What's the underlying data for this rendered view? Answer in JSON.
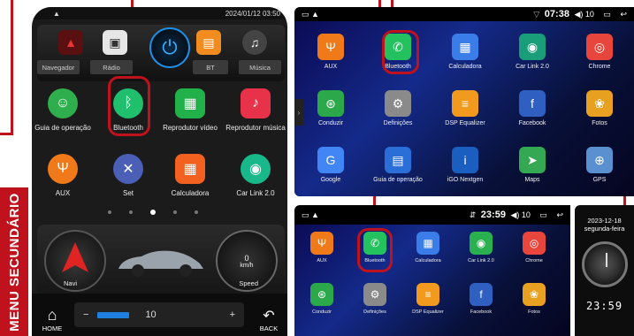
{
  "banner": "MENU SECUNDÁRIO",
  "device1": {
    "status_time": "2024/01/12 03:50",
    "dock": [
      {
        "label": "Navegador",
        "icon": "compass-icon",
        "color": "#d9d9d9"
      },
      {
        "label": "Rádio",
        "icon": "radio-icon",
        "color": "#e6e6e6"
      },
      {
        "label": "BT",
        "icon": "contacts-book-icon",
        "color": "#f28c1e"
      },
      {
        "label": "Música",
        "icon": "music-disc-icon",
        "color": "#6a6a6a"
      }
    ],
    "apps_row1": [
      {
        "label": "Guia de operação",
        "icon": "person-guide-icon",
        "color": "#2fae4e"
      },
      {
        "label": "Bluetooth",
        "icon": "bluetooth-icon",
        "color": "#1fbf6e"
      },
      {
        "label": "Reprodutor vídeo",
        "icon": "video-player-icon",
        "color": "#22b04b"
      },
      {
        "label": "Reprodutor música",
        "icon": "music-note-icon",
        "color": "#e8324a"
      }
    ],
    "apps_row2": [
      {
        "label": "AUX",
        "icon": "aux-icon",
        "color": "#f07a1a"
      },
      {
        "label": "Set",
        "icon": "tools-icon",
        "color": "#4a5fb5"
      },
      {
        "label": "Calculadora",
        "icon": "calculator-icon",
        "color": "#f2611f"
      },
      {
        "label": "Car Link 2.0",
        "icon": "carlink-icon",
        "color": "#19b88a"
      }
    ],
    "widget": {
      "left_label": "Navi",
      "right_label": "Speed",
      "speed_value": "0",
      "speed_unit": "km/h"
    },
    "bottom": {
      "home": "HOME",
      "back": "BACK",
      "volume": "10",
      "minus": "−",
      "plus": "+"
    }
  },
  "device2": {
    "status_time": "07:38",
    "status_volume": "10",
    "apps": [
      {
        "label": "AUX",
        "icon": "aux-icon",
        "color": "#f07a1a"
      },
      {
        "label": "Bluetooth",
        "icon": "phone-icon",
        "color": "#23c25e"
      },
      {
        "label": "Calculadora",
        "icon": "calculator-icon",
        "color": "#3a7de8"
      },
      {
        "label": "Car Link 2.0",
        "icon": "carlink-icon",
        "color": "#1a9e7a"
      },
      {
        "label": "Chrome",
        "icon": "chrome-icon",
        "color": "#e8453c"
      },
      {
        "label": "Conduzir",
        "icon": "steering-wheel-icon",
        "color": "#2aa84a"
      },
      {
        "label": "Definições",
        "icon": "settings-icon",
        "color": "#8a8a8a"
      },
      {
        "label": "DSP Equalizer",
        "icon": "equalizer-icon",
        "color": "#f29a1e"
      },
      {
        "label": "Facebook",
        "icon": "facebook-icon",
        "color": "#2f5fc0"
      },
      {
        "label": "Fotos",
        "icon": "photos-icon",
        "color": "#e8a020"
      },
      {
        "label": "Google",
        "icon": "google-icon",
        "color": "#4285f4"
      },
      {
        "label": "Guia de operação",
        "icon": "guide-book-icon",
        "color": "#2a6fd8"
      },
      {
        "label": "iGO Nextgen",
        "icon": "igo-icon",
        "color": "#1a5ec0"
      },
      {
        "label": "Maps",
        "icon": "maps-icon",
        "color": "#34a853"
      },
      {
        "label": "GPS",
        "icon": "gps-icon",
        "color": "#5a8fd0"
      }
    ]
  },
  "device3": {
    "status_time": "23:59",
    "status_volume": "10",
    "apps": [
      {
        "label": "AUX",
        "icon": "aux-icon",
        "color": "#f07a1a"
      },
      {
        "label": "Bluetooth",
        "icon": "phone-icon",
        "color": "#23c25e"
      },
      {
        "label": "Calculadora",
        "icon": "calculator-icon",
        "color": "#3a7de8"
      },
      {
        "label": "Car Link 2.0",
        "icon": "carlink-icon",
        "color": "#2bb04f"
      },
      {
        "label": "Chrome",
        "icon": "chrome-icon",
        "color": "#e8453c"
      },
      {
        "label": "Conduzir",
        "icon": "steering-wheel-icon",
        "color": "#2aa84a"
      },
      {
        "label": "Definições",
        "icon": "settings-icon",
        "color": "#8a8a8a"
      },
      {
        "label": "DSP Equalizer",
        "icon": "equalizer-icon",
        "color": "#f29a1e"
      },
      {
        "label": "Facebook",
        "icon": "facebook-icon",
        "color": "#2f5fc0"
      },
      {
        "label": "Fotos",
        "icon": "photos-icon",
        "color": "#e8a020"
      }
    ]
  },
  "device4": {
    "date": "2023-12-18",
    "weekday": "segunda-feira",
    "time": "23:59"
  }
}
